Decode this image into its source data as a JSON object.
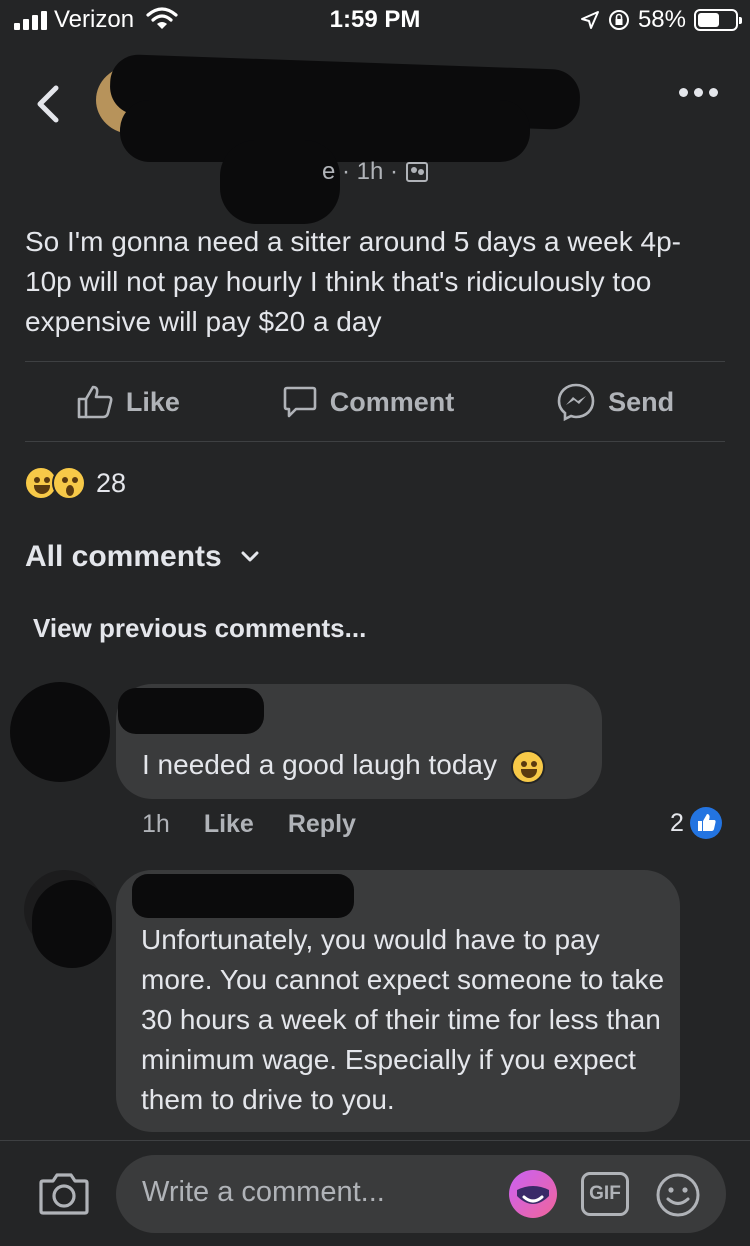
{
  "status_bar": {
    "carrier": "Verizon",
    "time": "1:59 PM",
    "battery": "58%",
    "battery_level": 0.58
  },
  "post": {
    "meta_time": "e · 1h ·",
    "text": "So I'm gonna need a sitter around 5 days a week 4p-10p will not pay hourly I think that's ridiculously too expensive will pay $20 a day",
    "actions": {
      "like": "Like",
      "comment": "Comment",
      "send": "Send"
    },
    "reaction_count": "28"
  },
  "comments_header": {
    "title": "All comments",
    "view_previous": "View previous comments..."
  },
  "comments": [
    {
      "text": "I needed a good laugh today",
      "time": "1h",
      "like": "Like",
      "reply": "Reply",
      "like_count": "2"
    },
    {
      "text": "Unfortunately, you would have to pay more. You cannot expect someone to take 30 hours a week of their time for less than minimum wage. Especially if you expect them to drive to you."
    }
  ],
  "composer": {
    "placeholder": "Write a comment...",
    "gif_label": "GIF"
  },
  "colors": {
    "background": "#242526",
    "bubble": "#3a3b3c",
    "text_primary": "#e4e6eb",
    "text_secondary": "#b0b3b8",
    "accent_blue": "#2374e1"
  }
}
